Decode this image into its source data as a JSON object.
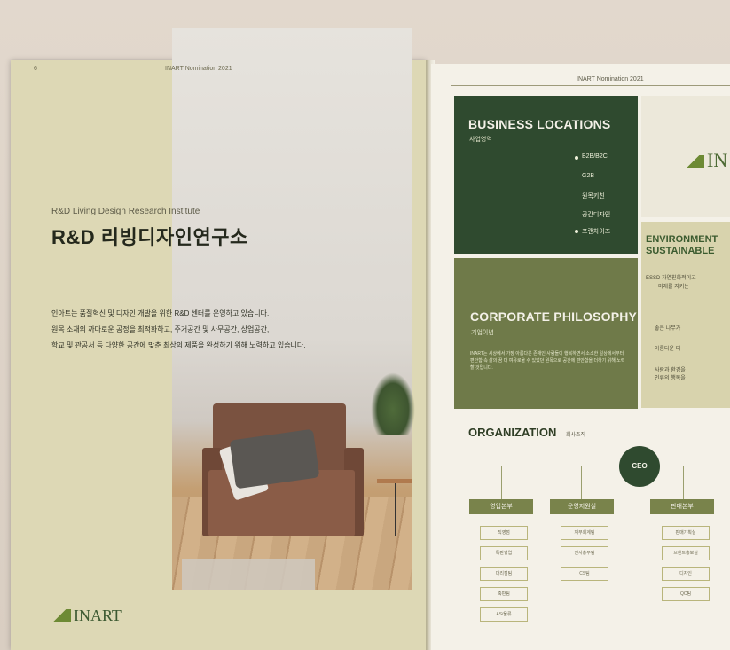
{
  "left_page": {
    "page_number": "6",
    "header": "INART Nomination 2021",
    "subtitle": "R&D Living Design Research Institute",
    "title": "R&D 리빙디자인연구소",
    "body": [
      "인아트는 품질혁신 및 디자인 개발을 위한 R&D 센터를 운영하고 있습니다.",
      "원목 소재의 까다로운 공정을 최적화하고, 주거공간 및 사무공간, 상업공간,",
      "학교 및 관공서 등 다양한 공간에 맞춘 최상의 제품을 완성하기 위해 노력하고 있습니다."
    ],
    "logo": "INART"
  },
  "right_page": {
    "header": "INART Nomination 2021",
    "business": {
      "title": "BUSINESS LOCATIONS",
      "subtitle": "사업영역",
      "items": [
        "B2B/B2C",
        "G2B",
        "원목키친",
        "공간디자인",
        "프랜차이즈"
      ]
    },
    "philosophy": {
      "title": "CORPORATE PHILOSOPHY",
      "subtitle": "기업이념",
      "body": "INART는 세상에서 가장 아름다운 존재인 사람들이 행복하면서 소소한 일상에서부터 편안함 속 삶의 꿈 더 여유로울 수 있었던 원목으로 공간에 편안함을 더하기 위해 노력할 것입니다."
    },
    "logo": "IN",
    "environment": {
      "title_1": "ENVIRONMENT",
      "title_2": "SUSTAINABLE",
      "lines": [
        "ESSD  자연친화적이고",
        "미래를 지키는",
        "좋은 나무가",
        "아름다운 디",
        "사람과 환경을",
        "인류의 행복을"
      ]
    },
    "organization": {
      "title": "ORGANIZATION",
      "subtitle": "회사조직",
      "ceo": "CEO",
      "departments": [
        {
          "name": "영업본부",
          "teams": [
            "직영점",
            "특판영업",
            "대리점팀",
            "축판팀",
            "AS/물류"
          ]
        },
        {
          "name": "운영지원실",
          "teams": [
            "재무회계팀",
            "인사총무팀",
            "CS팀"
          ]
        },
        {
          "name": "판매본부",
          "teams": [
            "판매기획실",
            "브랜드홍보실",
            "디자인",
            "QC팀"
          ]
        }
      ]
    }
  }
}
